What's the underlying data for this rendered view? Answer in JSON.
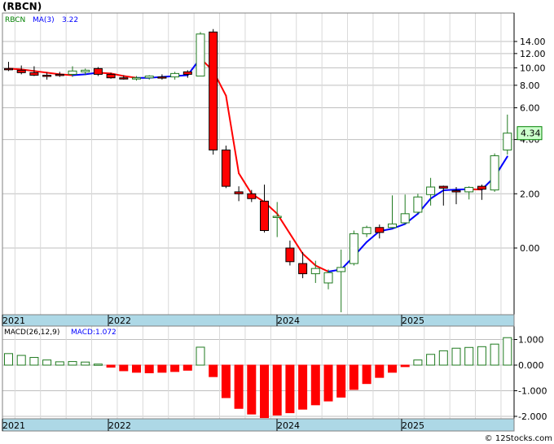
{
  "title": "(RBCN)",
  "copyright": "© 12Stocks.com",
  "colors": {
    "up": "#1f7a1f",
    "down": "#ff0000",
    "ma_blue": "#0000ff",
    "ma_red": "#ff0000",
    "axis_band": "#add8e6",
    "grid": "#bfbfbf",
    "price_tag": "#ccffcc"
  },
  "chart_data": [
    {
      "type": "candlestick",
      "ticker": "RBCN",
      "legend": [
        {
          "label": "RBCN",
          "color": "#008000"
        },
        {
          "label": "MA(3)",
          "color": "#0000ff"
        },
        {
          "label": "3.22",
          "color": "#0000ff"
        }
      ],
      "last_price_label": "4.34",
      "y_scale": "log",
      "y_ticks": [
        {
          "v": 14,
          "label": "14.00"
        },
        {
          "v": 12,
          "label": "12.00"
        },
        {
          "v": 10,
          "label": "10.00"
        },
        {
          "v": 8,
          "label": "8.00"
        },
        {
          "v": 6,
          "label": "6.00"
        },
        {
          "v": 4,
          "label": "4.00"
        },
        {
          "v": 2,
          "label": "2.00"
        },
        {
          "v": 1,
          "label": "0.00"
        }
      ],
      "x_labels": [
        "2021",
        "2022",
        "2024",
        "2025"
      ],
      "candles": [
        {
          "o": 9.9,
          "h": 10.8,
          "l": 9.6,
          "c": 9.8
        },
        {
          "o": 9.7,
          "h": 10.3,
          "l": 9.2,
          "c": 9.4
        },
        {
          "o": 9.4,
          "h": 10.2,
          "l": 9.0,
          "c": 9.1
        },
        {
          "o": 9.1,
          "h": 9.4,
          "l": 8.6,
          "c": 9.0
        },
        {
          "o": 9.2,
          "h": 9.5,
          "l": 8.9,
          "c": 9.1
        },
        {
          "o": 9.2,
          "h": 10.2,
          "l": 8.9,
          "c": 9.6
        },
        {
          "o": 9.5,
          "h": 9.9,
          "l": 9.1,
          "c": 9.7
        },
        {
          "o": 9.9,
          "h": 10.1,
          "l": 9.0,
          "c": 9.2
        },
        {
          "o": 9.2,
          "h": 9.4,
          "l": 8.7,
          "c": 8.8
        },
        {
          "o": 8.8,
          "h": 9.1,
          "l": 8.6,
          "c": 8.7
        },
        {
          "o": 8.7,
          "h": 9.0,
          "l": 8.5,
          "c": 8.8
        },
        {
          "o": 8.8,
          "h": 9.1,
          "l": 8.6,
          "c": 9.0
        },
        {
          "o": 8.9,
          "h": 9.2,
          "l": 8.6,
          "c": 8.8
        },
        {
          "o": 8.9,
          "h": 9.5,
          "l": 8.6,
          "c": 9.3
        },
        {
          "o": 9.5,
          "h": 9.7,
          "l": 8.8,
          "c": 9.2
        },
        {
          "o": 9.0,
          "h": 15.8,
          "l": 9.0,
          "c": 15.4
        },
        {
          "o": 15.8,
          "h": 16.4,
          "l": 3.3,
          "c": 3.5
        },
        {
          "o": 3.5,
          "h": 3.7,
          "l": 2.15,
          "c": 2.2
        },
        {
          "o": 2.05,
          "h": 2.2,
          "l": 1.82,
          "c": 2.0
        },
        {
          "o": 2.0,
          "h": 2.1,
          "l": 1.8,
          "c": 1.88
        },
        {
          "o": 1.82,
          "h": 2.25,
          "l": 1.22,
          "c": 1.25
        },
        {
          "o": 1.5,
          "h": 1.8,
          "l": 1.15,
          "c": 1.5
        },
        {
          "o": 1.0,
          "h": 1.1,
          "l": 0.8,
          "c": 0.84
        },
        {
          "o": 0.82,
          "h": 0.95,
          "l": 0.68,
          "c": 0.72
        },
        {
          "o": 0.72,
          "h": 0.85,
          "l": 0.64,
          "c": 0.77
        },
        {
          "o": 0.64,
          "h": 0.76,
          "l": 0.59,
          "c": 0.73
        },
        {
          "o": 0.74,
          "h": 0.98,
          "l": 0.44,
          "c": 0.78
        },
        {
          "o": 0.82,
          "h": 1.25,
          "l": 0.8,
          "c": 1.2
        },
        {
          "o": 1.2,
          "h": 1.33,
          "l": 1.15,
          "c": 1.3
        },
        {
          "o": 1.3,
          "h": 1.35,
          "l": 1.13,
          "c": 1.22
        },
        {
          "o": 1.3,
          "h": 1.96,
          "l": 1.28,
          "c": 1.36
        },
        {
          "o": 1.38,
          "h": 1.98,
          "l": 1.35,
          "c": 1.55
        },
        {
          "o": 1.58,
          "h": 2.0,
          "l": 1.55,
          "c": 1.92
        },
        {
          "o": 1.98,
          "h": 2.45,
          "l": 1.72,
          "c": 2.18
        },
        {
          "o": 2.2,
          "h": 2.22,
          "l": 1.72,
          "c": 2.15
        },
        {
          "o": 2.08,
          "h": 2.18,
          "l": 1.75,
          "c": 2.05
        },
        {
          "o": 2.05,
          "h": 2.2,
          "l": 1.86,
          "c": 2.17
        },
        {
          "o": 2.2,
          "h": 2.25,
          "l": 1.85,
          "c": 2.12
        },
        {
          "o": 2.1,
          "h": 3.35,
          "l": 2.05,
          "c": 3.25
        },
        {
          "o": 3.5,
          "h": 5.5,
          "l": 3.3,
          "c": 4.34
        }
      ],
      "ma": [
        9.9,
        9.8,
        9.6,
        9.4,
        9.2,
        9.1,
        9.2,
        9.4,
        9.3,
        9.0,
        8.8,
        8.8,
        8.9,
        9.0,
        9.1,
        11.3,
        9.6,
        7.0,
        2.6,
        2.0,
        1.8,
        1.55,
        1.2,
        0.93,
        0.8,
        0.74,
        0.76,
        0.9,
        1.08,
        1.24,
        1.28,
        1.36,
        1.55,
        1.88,
        2.09,
        2.11,
        2.12,
        2.11,
        2.48,
        3.22
      ],
      "ma_colors": [
        "red",
        "red",
        "red",
        "red",
        "red",
        "red",
        "blue",
        "blue",
        "red",
        "red",
        "red",
        "blue",
        "blue",
        "blue",
        "blue",
        "blue",
        "red",
        "red",
        "red",
        "red",
        "red",
        "red",
        "red",
        "red",
        "red",
        "red",
        "blue",
        "blue",
        "blue",
        "blue",
        "blue",
        "blue",
        "blue",
        "blue",
        "blue",
        "blue",
        "blue",
        "red",
        "blue",
        "blue"
      ]
    },
    {
      "type": "bar",
      "label": "MACD(26,12,9)",
      "value_label": "MACD:1.072",
      "y_ticks": [
        {
          "v": 1,
          "label": "1.000"
        },
        {
          "v": 0,
          "label": "0.000"
        },
        {
          "v": -1,
          "label": "-1.000"
        },
        {
          "v": -2,
          "label": "-2.000"
        }
      ],
      "x_labels": [
        "2021",
        "2022",
        "2024",
        "2025"
      ],
      "values": [
        0.45,
        0.38,
        0.3,
        0.2,
        0.13,
        0.14,
        0.12,
        0.04,
        -0.08,
        -0.22,
        -0.28,
        -0.3,
        -0.28,
        -0.25,
        -0.2,
        0.7,
        -0.45,
        -1.27,
        -1.69,
        -1.91,
        -2.05,
        -1.95,
        -1.86,
        -1.72,
        -1.55,
        -1.4,
        -1.25,
        -0.95,
        -0.72,
        -0.48,
        -0.28,
        -0.06,
        0.2,
        0.42,
        0.56,
        0.66,
        0.69,
        0.72,
        0.82,
        1.072
      ]
    }
  ]
}
